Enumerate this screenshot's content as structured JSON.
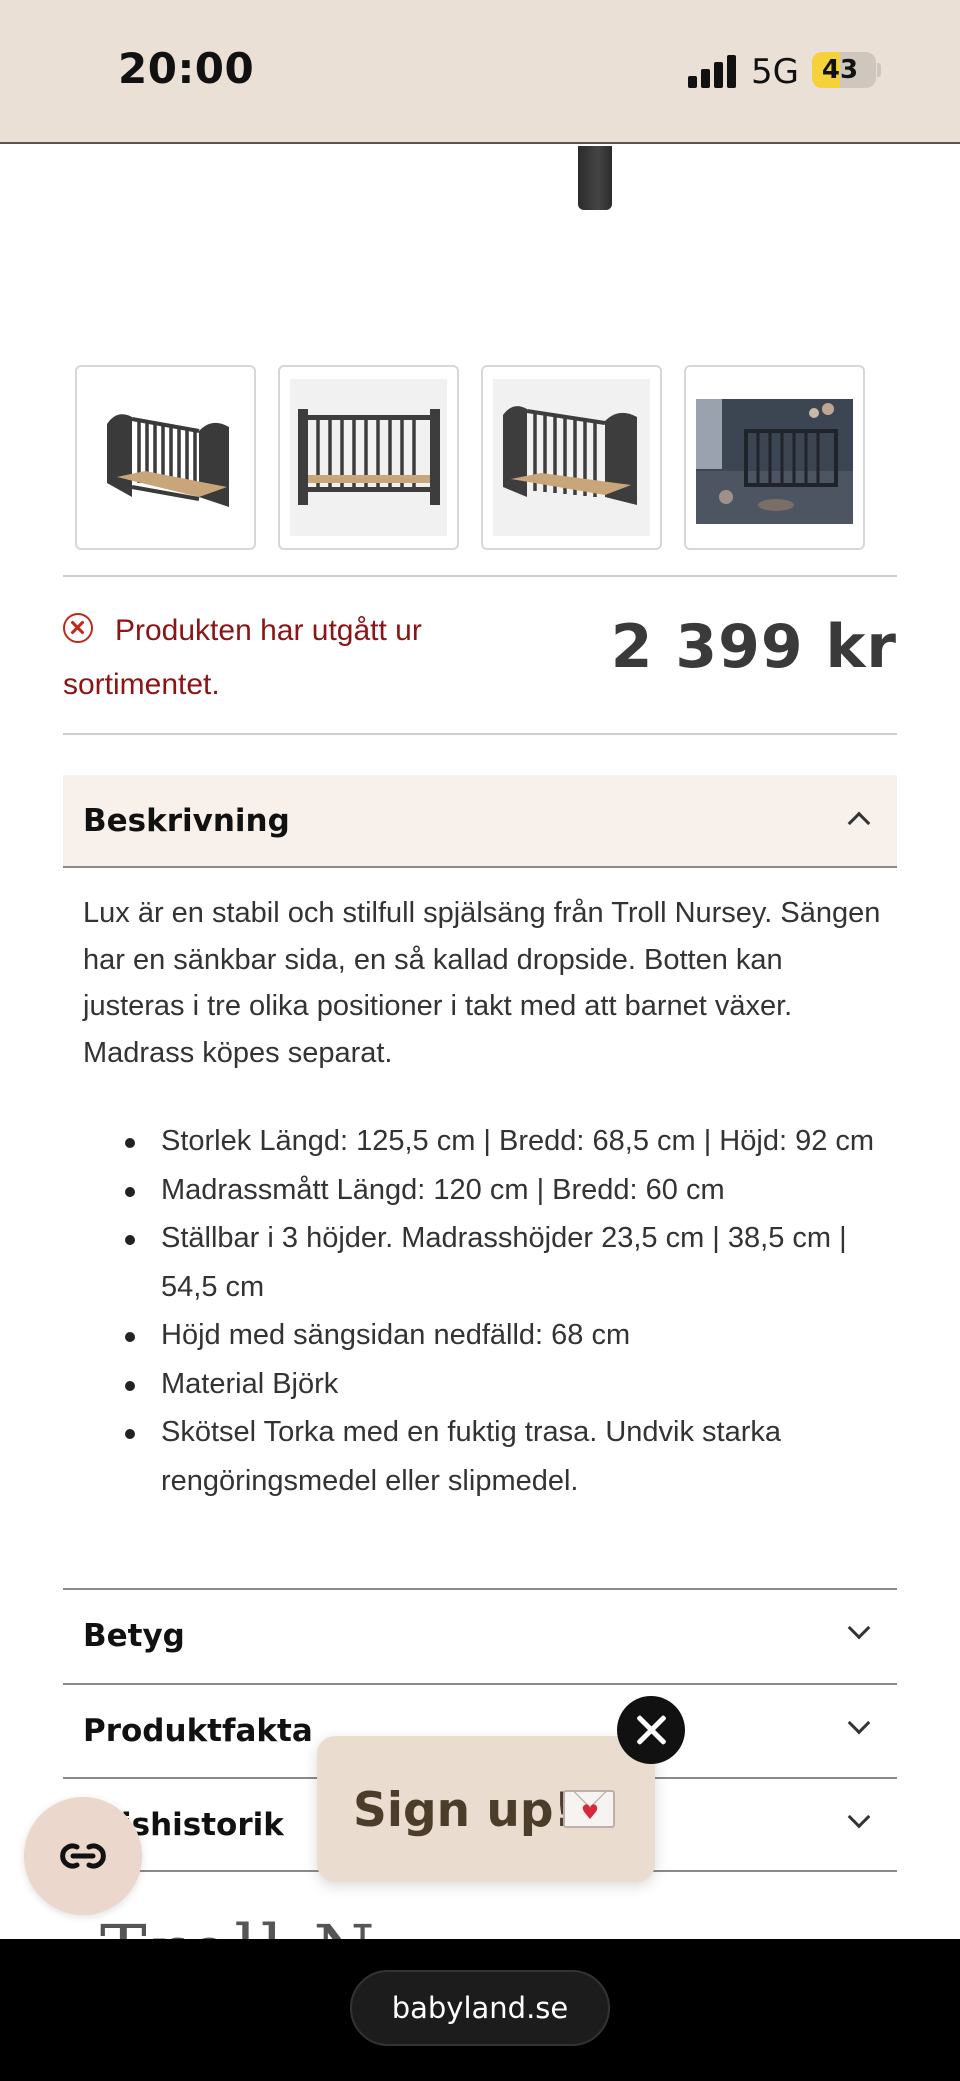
{
  "status_bar": {
    "time": "20:00",
    "network": "5G",
    "battery": "43",
    "battery_level": 0.43
  },
  "thumbnails": [
    {
      "icon": "crib-photo-icon",
      "label": "Crib front view"
    },
    {
      "icon": "crib-photo-icon",
      "label": "Crib side view"
    },
    {
      "icon": "crib-photo-icon",
      "label": "Crib angled view"
    },
    {
      "icon": "room-photo-icon",
      "label": "Crib in nursery room"
    }
  ],
  "availability": {
    "icon": "error-circle-icon",
    "text": "Produkten har utgått ur sortimentet.",
    "color": "#8c1414"
  },
  "price": "2 399 kr",
  "description_section": {
    "title": "Beskrivning",
    "expanded": true,
    "text": "Lux är en stabil och stilfull spjälsäng från Troll Nursey. Sängen har en sänkbar sida, en så kallad dropside. Botten kan justeras i tre olika positioner i takt med att barnet växer. Madrass köpes separat.",
    "bullets": [
      "Storlek Längd: 125,5 cm | Bredd: 68,5 cm | Höjd: 92 cm",
      "Madrassmått Längd: 120 cm | Bredd: 60 cm",
      "Ställbar i 3 höjder. Madrasshöjder 23,5 cm | 38,5 cm | 54,5 cm",
      "Höjd med sängsidan nedfälld: 68 cm",
      "Material Björk",
      "Skötsel Torka med en fuktig trasa. Undvik starka rengöringsmedel eller slipmedel."
    ]
  },
  "sections": {
    "rating": "Betyg",
    "product_facts": "Produktfakta",
    "price_history": "Prishistorik"
  },
  "signup_popup": {
    "label": "Sign up!",
    "icon": "love-letter-icon"
  },
  "chat": {
    "icon": "chat-logo-icon"
  },
  "browser": {
    "url": "babyland.se"
  },
  "colors": {
    "status_bar_bg": "#ebe0d6",
    "accordion_open_bg": "#f8f0ea",
    "signup_bg": "#ebdcd0",
    "error_red": "#c0281e"
  }
}
